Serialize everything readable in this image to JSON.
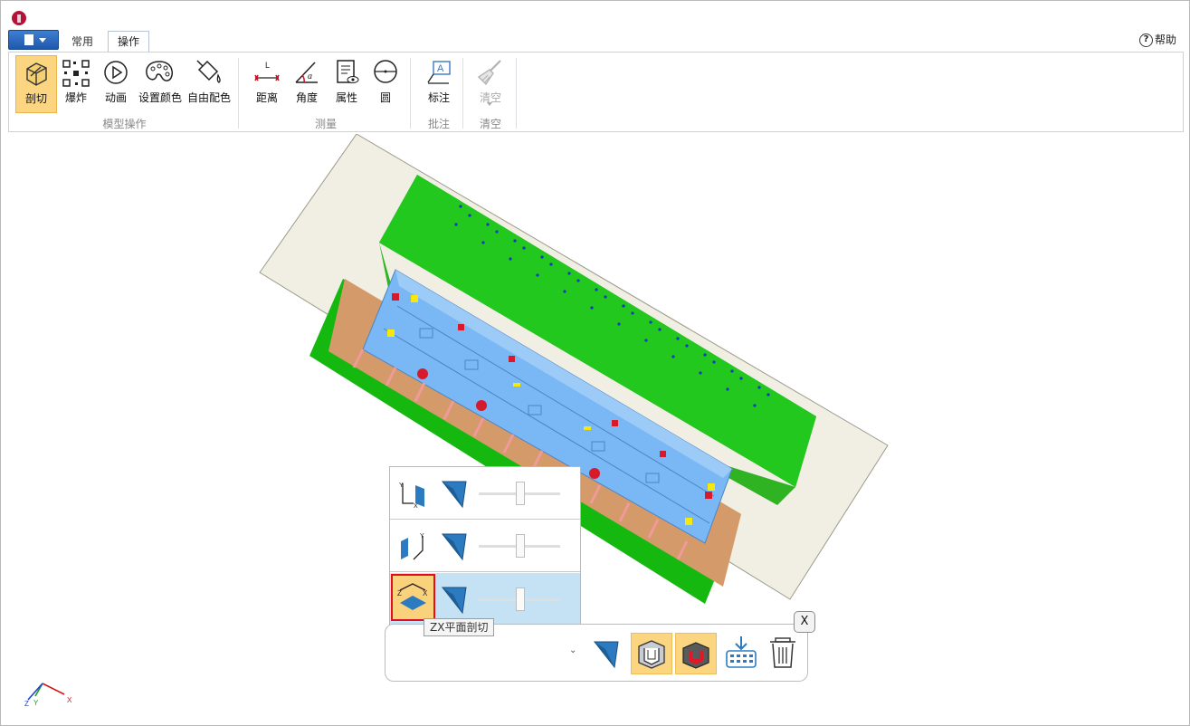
{
  "window": {
    "title": ""
  },
  "file_button": {
    "icon": "document-icon"
  },
  "tabs": [
    {
      "label": "常用",
      "active": false
    },
    {
      "label": "操作",
      "active": true
    }
  ],
  "help": {
    "label": "帮助"
  },
  "ribbon": {
    "groups": [
      {
        "label": "模型操作",
        "buttons": [
          {
            "label": "剖切",
            "icon": "section-cut-icon",
            "active": true
          },
          {
            "label": "爆炸",
            "icon": "explode-icon"
          },
          {
            "label": "动画",
            "icon": "play-icon"
          },
          {
            "label": "设置颜色",
            "icon": "palette-icon"
          },
          {
            "label": "自由配色",
            "icon": "paint-bucket-icon"
          }
        ]
      },
      {
        "label": "测量",
        "buttons": [
          {
            "label": "距离",
            "icon": "distance-icon"
          },
          {
            "label": "角度",
            "icon": "angle-icon"
          },
          {
            "label": "属性",
            "icon": "properties-icon"
          },
          {
            "label": "圆",
            "icon": "circle-icon"
          }
        ]
      },
      {
        "label": "批注",
        "buttons": [
          {
            "label": "标注",
            "icon": "annotation-icon"
          }
        ]
      },
      {
        "label": "清空",
        "buttons": [
          {
            "label": "清空",
            "icon": "broom-icon",
            "disabled": true
          }
        ]
      }
    ]
  },
  "section_panel": {
    "rows": [
      {
        "plane": "XY",
        "slider_value": 0.5,
        "selected": false
      },
      {
        "plane": "YZ",
        "slider_value": 0.5,
        "selected": false
      },
      {
        "plane": "ZX",
        "slider_value": 0.5,
        "selected": true
      }
    ],
    "current": {
      "plane": "XY",
      "slider_value": 0.5
    }
  },
  "tooltip": {
    "text": "ZX平面剖切"
  },
  "section_toolbar": {
    "close_label": "X",
    "buttons": [
      {
        "icon": "reverse-cut-icon",
        "on": false
      },
      {
        "icon": "show-cut-face-icon",
        "on": true
      },
      {
        "icon": "fill-cut-face-icon",
        "on": true
      },
      {
        "icon": "save-section-icon",
        "on": false
      },
      {
        "icon": "trash-icon",
        "on": false
      }
    ]
  },
  "axis_triad": {
    "x": "X",
    "y": "Y",
    "z": "Z"
  },
  "colors": {
    "ribbon_active": "#fbd580",
    "selected_row": "#c4e2f4",
    "highlight_border": "#e00e22",
    "model_green": "#22c81e",
    "model_blue": "#79b8f4",
    "model_tan": "#d49a6a"
  }
}
